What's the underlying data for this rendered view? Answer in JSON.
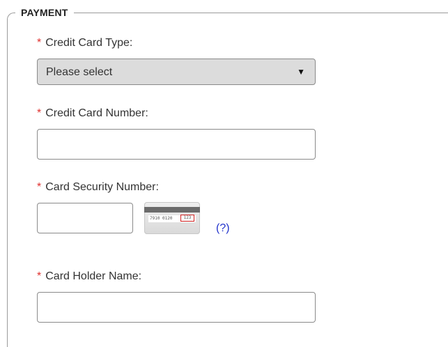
{
  "legend": "PAYMENT",
  "required_marker": "*",
  "fields": {
    "card_type": {
      "label": "Credit Card Type:",
      "selected": "Please select",
      "arrow": "▼"
    },
    "card_number": {
      "label": "Credit Card Number:",
      "value": ""
    },
    "security_number": {
      "label": "Card Security Number:",
      "value": "",
      "card_image": {
        "digits": "7910 0120",
        "code": "123"
      },
      "help_link": "(?)"
    },
    "holder_name": {
      "label": "Card Holder Name:",
      "value": ""
    }
  },
  "colors": {
    "required": "#e0312f",
    "link": "#2233cc",
    "select_bg": "#dcdcdc",
    "border": "#8a8a8a"
  }
}
